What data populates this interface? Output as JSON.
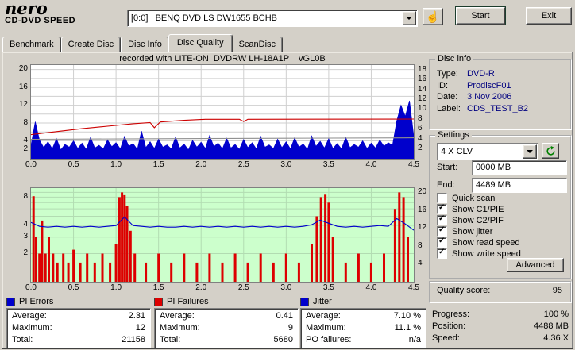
{
  "colors": {
    "window_bg": "#d4d0c8",
    "pi_errors_blue": "#0000cc",
    "pi_failures_red": "#dd0000",
    "jitter_blue": "#0000cc",
    "read_speed_gray": "#909090",
    "write_speed_red": "#cc0000",
    "chart2_bg": "#ccffcc",
    "info_value_blue": "#000080"
  },
  "header": {
    "logo_main": "nero",
    "logo_sub": "CD-DVD SPEED",
    "drive_select": "[0:0]   BENQ DVD LS DW1655 BCHB",
    "start_button": "Start",
    "exit_button": "Exit"
  },
  "tabs": {
    "active": "Disc Quality",
    "items": [
      {
        "label": "Benchmark"
      },
      {
        "label": "Create Disc"
      },
      {
        "label": "Disc Info"
      },
      {
        "label": "Disc Quality"
      },
      {
        "label": "ScanDisc"
      }
    ]
  },
  "disc_info": {
    "title": "Disc info",
    "rows": [
      {
        "label": "Type:",
        "value": "DVD-R"
      },
      {
        "label": "ID:",
        "value": "ProdiscF01"
      },
      {
        "label": "Date:",
        "value": "3 Nov 2006"
      },
      {
        "label": "Label:",
        "value": "CDS_TEST_B2"
      }
    ]
  },
  "settings": {
    "title": "Settings",
    "speed_select": "4 X CLV",
    "start_label": "Start:",
    "start_value": "0000 MB",
    "end_label": "End:",
    "end_value": "4489 MB",
    "checkboxes": [
      {
        "label": "Quick scan",
        "checked": false
      },
      {
        "label": "Show C1/PIE",
        "checked": true
      },
      {
        "label": "Show C2/PIF",
        "checked": true
      },
      {
        "label": "Show jitter",
        "checked": true
      },
      {
        "label": "Show read speed",
        "checked": true
      },
      {
        "label": "Show write speed",
        "checked": true
      }
    ],
    "advanced_button": "Advanced"
  },
  "quality": {
    "label": "Quality score:",
    "value": "95"
  },
  "legend_stats": {
    "pi_errors": {
      "title": "PI Errors",
      "rows": [
        {
          "label": "Average:",
          "value": "2.31"
        },
        {
          "label": "Maximum:",
          "value": "12"
        },
        {
          "label": "Total:",
          "value": "21158"
        }
      ]
    },
    "pi_failures": {
      "title": "PI Failures",
      "rows": [
        {
          "label": "Average:",
          "value": "0.41"
        },
        {
          "label": "Maximum:",
          "value": "9"
        },
        {
          "label": "Total:",
          "value": "5680"
        }
      ]
    },
    "jitter": {
      "title": "Jitter",
      "rows": [
        {
          "label": "Average:",
          "value": "7.10 %"
        },
        {
          "label": "Maximum:",
          "value": "11.1 %"
        },
        {
          "label": "PO failures:",
          "value": "n/a"
        }
      ]
    }
  },
  "progress_panel": {
    "rows": [
      {
        "label": "Progress:",
        "value": "100 %"
      },
      {
        "label": "Position:",
        "value": "4488 MB"
      },
      {
        "label": "Speed:",
        "value": "4.36 X"
      }
    ]
  },
  "chart_data": [
    {
      "type": "area",
      "title": "recorded with LITE-ON  DVDRW LH-18A1P    vGL0B",
      "x_range": [
        0,
        4.5
      ],
      "x_ticks": [
        "0.0",
        "0.5",
        "1.0",
        "1.5",
        "2.0",
        "2.5",
        "3.0",
        "3.5",
        "4.0",
        "4.5"
      ],
      "left_axis": {
        "range": [
          0,
          21
        ],
        "ticks": [
          20,
          16,
          12,
          8,
          4,
          2
        ]
      },
      "right_axis": {
        "range": [
          0,
          19
        ],
        "ticks": [
          18,
          16,
          14,
          12,
          10,
          8,
          6,
          4,
          2
        ]
      },
      "series": [
        {
          "name": "PI Errors",
          "axis": "left",
          "style": "area",
          "color": "#0000cc",
          "x_step": 0.05,
          "values": [
            3.0,
            8.3,
            4.2,
            2.5,
            3.8,
            2.2,
            4.5,
            2.0,
            3.2,
            2.6,
            4.0,
            2.3,
            3.5,
            2.1,
            4.8,
            2.4,
            3.0,
            2.2,
            4.2,
            2.7,
            3.6,
            2.2,
            5.0,
            2.8,
            3.4,
            2.1,
            6.2,
            2.5,
            3.8,
            2.3,
            4.4,
            2.6,
            3.1,
            2.2,
            4.9,
            2.4,
            3.3,
            2.0,
            4.1,
            2.6,
            3.7,
            2.3,
            5.2,
            2.7,
            3.5,
            2.2,
            4.6,
            2.4,
            3.2,
            2.1,
            4.3,
            2.5,
            3.6,
            2.2,
            5.0,
            2.6,
            3.1,
            2.3,
            4.4,
            2.5,
            3.8,
            2.2,
            4.7,
            2.6,
            3.3,
            2.1,
            5.1,
            2.8,
            3.9,
            2.4,
            4.5,
            2.3,
            3.4,
            2.2,
            4.8,
            2.5,
            3.2,
            2.6,
            4.0,
            2.3,
            3.5,
            2.4,
            4.2,
            2.8,
            3.6,
            3.0,
            8.5,
            12.0,
            9.5,
            13.0,
            5.0
          ]
        },
        {
          "name": "Read speed",
          "axis": "right",
          "style": "line",
          "color": "#909090",
          "points": [
            [
              0,
              3.95
            ],
            [
              1.5,
              4.05
            ],
            [
              3,
              4.15
            ],
            [
              4.5,
              4.25
            ]
          ]
        },
        {
          "name": "Write speed",
          "axis": "right",
          "style": "line",
          "color": "#cc0000",
          "points": [
            [
              0,
              4.9
            ],
            [
              0.3,
              5.5
            ],
            [
              0.6,
              6.1
            ],
            [
              0.9,
              6.6
            ],
            [
              1.2,
              7.1
            ],
            [
              1.4,
              7.35
            ],
            [
              1.45,
              6.3
            ],
            [
              1.52,
              7.45
            ],
            [
              1.8,
              7.8
            ],
            [
              2.05,
              8.0
            ],
            [
              2.45,
              8.0
            ],
            [
              2.5,
              7.55
            ],
            [
              2.55,
              8.0
            ],
            [
              4.5,
              8.05
            ]
          ]
        }
      ]
    },
    {
      "type": "bar",
      "background": "#ccffcc",
      "x_range": [
        0,
        4.5
      ],
      "x_ticks": [
        "0.0",
        "0.5",
        "1.0",
        "1.5",
        "2.0",
        "2.5",
        "3.0",
        "3.5",
        "4.0",
        "4.5"
      ],
      "left_axis": {
        "scale": "log",
        "range": [
          1,
          10
        ],
        "ticks": [
          8,
          4,
          3,
          2
        ]
      },
      "right_axis": {
        "range": [
          0,
          21
        ],
        "ticks": [
          20,
          16,
          12,
          8,
          4
        ]
      },
      "bars": {
        "name": "PI Failures",
        "color": "#dd0000",
        "points": [
          [
            0.03,
            8.2
          ],
          [
            0.06,
            3
          ],
          [
            0.1,
            2
          ],
          [
            0.13,
            4.5
          ],
          [
            0.17,
            2
          ],
          [
            0.21,
            3
          ],
          [
            0.26,
            2
          ],
          [
            0.31,
            1.6
          ],
          [
            0.38,
            2
          ],
          [
            0.44,
            1.6
          ],
          [
            0.5,
            2.2
          ],
          [
            0.58,
            1.6
          ],
          [
            0.66,
            2
          ],
          [
            0.75,
            1.6
          ],
          [
            0.84,
            2
          ],
          [
            0.93,
            1.6
          ],
          [
            1.0,
            2.5
          ],
          [
            1.04,
            8
          ],
          [
            1.07,
            9
          ],
          [
            1.1,
            8.4
          ],
          [
            1.13,
            6.5
          ],
          [
            1.17,
            3.5
          ],
          [
            1.22,
            2
          ],
          [
            1.35,
            1.6
          ],
          [
            1.5,
            2
          ],
          [
            1.65,
            1.6
          ],
          [
            1.8,
            2
          ],
          [
            1.95,
            1.6
          ],
          [
            2.1,
            2
          ],
          [
            2.25,
            1.6
          ],
          [
            2.4,
            2
          ],
          [
            2.55,
            1.6
          ],
          [
            2.7,
            2
          ],
          [
            2.85,
            1.6
          ],
          [
            3.0,
            2
          ],
          [
            3.15,
            1.6
          ],
          [
            3.3,
            2.5
          ],
          [
            3.36,
            5
          ],
          [
            3.41,
            8
          ],
          [
            3.46,
            8.5
          ],
          [
            3.5,
            7
          ],
          [
            3.55,
            3
          ],
          [
            3.7,
            1.6
          ],
          [
            3.85,
            2
          ],
          [
            4.0,
            1.6
          ],
          [
            4.15,
            2
          ],
          [
            4.28,
            6
          ],
          [
            4.33,
            9
          ],
          [
            4.38,
            8
          ],
          [
            4.43,
            3
          ]
        ]
      },
      "line": {
        "name": "Jitter (%)",
        "color": "#0000cc",
        "axis_range": [
          0,
          12
        ],
        "x_step": 0.1,
        "values": [
          7.6,
          7.1,
          7.0,
          7.1,
          7.0,
          7.1,
          7.0,
          7.1,
          7.0,
          7.1,
          7.2,
          8.3,
          7.2,
          7.1,
          7.0,
          7.1,
          7.0,
          7.0,
          7.1,
          7.0,
          7.1,
          7.0,
          7.1,
          7.0,
          7.1,
          7.0,
          7.1,
          7.0,
          7.1,
          7.0,
          7.1,
          7.0,
          7.1,
          7.3,
          7.9,
          7.5,
          7.1,
          7.0,
          7.1,
          7.0,
          7.1,
          7.2,
          7.1,
          8.1,
          7.4,
          6.6
        ]
      }
    }
  ]
}
